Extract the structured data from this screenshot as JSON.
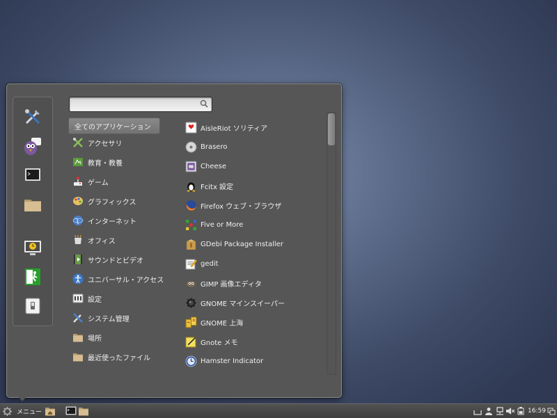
{
  "colors": {
    "panel": "#565656",
    "text": "#f0f0f0",
    "taskbar": "#474747"
  },
  "search": {
    "value": "",
    "placeholder": ""
  },
  "favorites": [
    {
      "name": "system-settings-icon"
    },
    {
      "name": "pidgin-icon"
    },
    {
      "name": "terminal-icon"
    },
    {
      "name": "files-icon"
    },
    {
      "name": "lock-screen-icon"
    },
    {
      "name": "logout-icon"
    },
    {
      "name": "shutdown-icon"
    }
  ],
  "categories": [
    {
      "label": "全てのアプリケーション"
    },
    {
      "label": "アクセサリ"
    },
    {
      "label": "教育・教養"
    },
    {
      "label": "ゲーム"
    },
    {
      "label": "グラフィックス"
    },
    {
      "label": "インターネット"
    },
    {
      "label": "オフィス"
    },
    {
      "label": "サウンドとビデオ"
    },
    {
      "label": "ユニバーサル・アクセス"
    },
    {
      "label": "設定"
    },
    {
      "label": "システム管理"
    },
    {
      "label": "場所"
    },
    {
      "label": "最近使ったファイル"
    }
  ],
  "apps": [
    {
      "label": "AisleRiot ソリティア"
    },
    {
      "label": "Brasero"
    },
    {
      "label": "Cheese"
    },
    {
      "label": "Fcitx 設定"
    },
    {
      "label": "Firefox ウェブ・ブラウザ"
    },
    {
      "label": "Five or More"
    },
    {
      "label": "GDebi Package Installer"
    },
    {
      "label": "gedit"
    },
    {
      "label": "GIMP 画像エディタ"
    },
    {
      "label": "GNOME マインスイーパー"
    },
    {
      "label": "GNOME 上海"
    },
    {
      "label": "Gnote メモ"
    },
    {
      "label": "Hamster Indicator"
    }
  ],
  "taskbar": {
    "menu_label": "メニュー",
    "clock": "16:59"
  }
}
